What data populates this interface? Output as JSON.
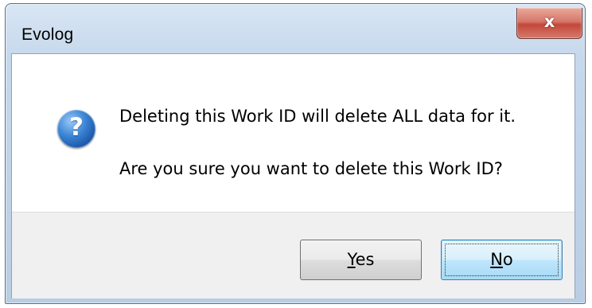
{
  "window": {
    "title": "Evolog",
    "close_glyph": "x"
  },
  "dialog": {
    "icon": "question-icon",
    "icon_glyph": "?",
    "message_line1": "Deleting this Work ID will delete ALL data for it.",
    "message_line2": "Are you sure you want to delete this Work ID?"
  },
  "buttons": {
    "yes": {
      "mnemonic": "Y",
      "rest": "es"
    },
    "no": {
      "mnemonic": "N",
      "rest": "o"
    }
  },
  "colors": {
    "close_button": "#c2483a",
    "default_button_border": "#3c7fb1",
    "icon_blue": "#3d86d6"
  }
}
